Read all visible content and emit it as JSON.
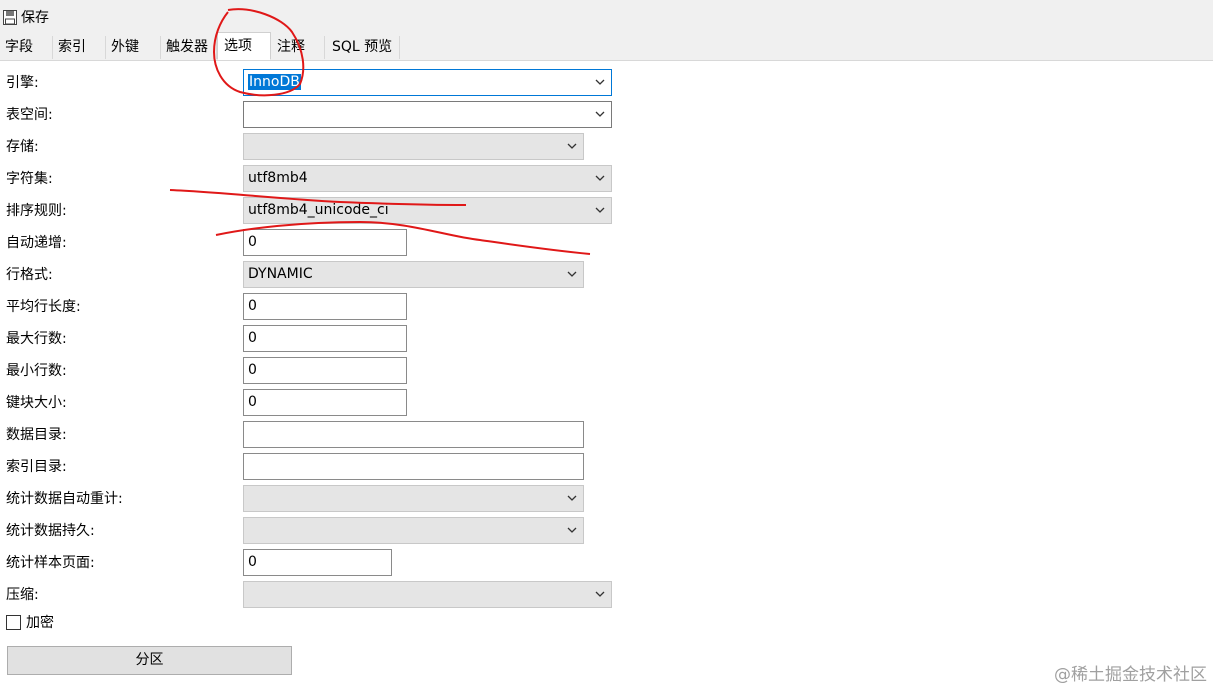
{
  "toolbar": {
    "save_label": "保存"
  },
  "tabs": [
    {
      "label": "字段"
    },
    {
      "label": "索引"
    },
    {
      "label": "外键"
    },
    {
      "label": "触发器"
    },
    {
      "label": "选项"
    },
    {
      "label": "注释"
    },
    {
      "label": "SQL 预览"
    }
  ],
  "active_tab": "选项",
  "options": {
    "engine": {
      "label": "引擎:",
      "value": "InnoDB"
    },
    "tablespace": {
      "label": "表空间:",
      "value": ""
    },
    "storage": {
      "label": "存储:",
      "value": ""
    },
    "charset": {
      "label": "字符集:",
      "value": "utf8mb4"
    },
    "collation": {
      "label": "排序规则:",
      "value": "utf8mb4_unicode_ci"
    },
    "auto_increment": {
      "label": "自动递增:",
      "value": "0"
    },
    "row_format": {
      "label": "行格式:",
      "value": "DYNAMIC"
    },
    "avg_row_length": {
      "label": "平均行长度:",
      "value": "0"
    },
    "max_rows": {
      "label": "最大行数:",
      "value": "0"
    },
    "min_rows": {
      "label": "最小行数:",
      "value": "0"
    },
    "key_block_size": {
      "label": "键块大小:",
      "value": "0"
    },
    "data_directory": {
      "label": "数据目录:",
      "value": ""
    },
    "index_directory": {
      "label": "索引目录:",
      "value": ""
    },
    "stats_auto_recalc": {
      "label": "统计数据自动重计:",
      "value": ""
    },
    "stats_persistent": {
      "label": "统计数据持久:",
      "value": ""
    },
    "stats_sample_pages": {
      "label": "统计样本页面:",
      "value": "0"
    },
    "compression": {
      "label": "压缩:",
      "value": ""
    },
    "encryption": {
      "label": "加密",
      "checked": false
    }
  },
  "partition_button": "分区",
  "watermark": "@稀土掘金技术社区",
  "colors": {
    "annotation": "#e01818",
    "focus": "#0078d7"
  }
}
